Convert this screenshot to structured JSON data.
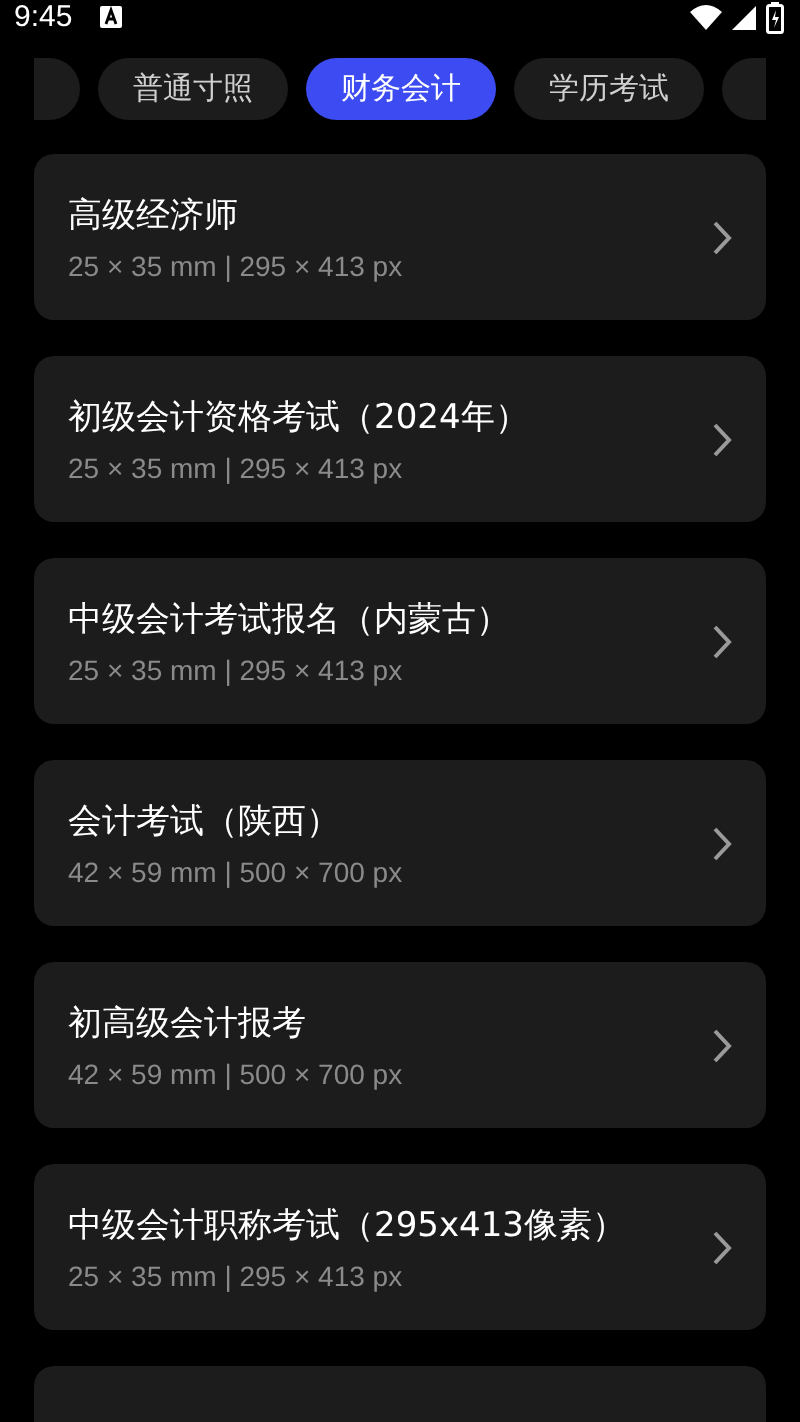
{
  "status_bar": {
    "time": "9:45"
  },
  "tabs": [
    {
      "selected": false
    },
    {
      "label": "普通寸照",
      "selected": false
    },
    {
      "label": "财务会计",
      "selected": true
    },
    {
      "label": "学历考试",
      "selected": false
    },
    {
      "selected": false
    }
  ],
  "items": [
    {
      "kind": "entry",
      "title": "高级经济师",
      "size": "25 × 35 mm | 295 × 413 px"
    },
    {
      "kind": "entry",
      "title": "初级会计资格考试（2024年）",
      "size": "25 × 35 mm | 295 × 413 px"
    },
    {
      "kind": "entry",
      "title": "中级会计考试报名（内蒙古）",
      "size": "25 × 35 mm | 295 × 413 px"
    },
    {
      "kind": "entry",
      "title": "会计考试（陕西）",
      "size": "42 × 59 mm | 500 × 700 px"
    },
    {
      "kind": "entry",
      "title": "初高级会计报考",
      "size": "42 × 59 mm | 500 × 700 px"
    },
    {
      "kind": "entry",
      "title": "中级会计职称考试（295x413像素）",
      "size": "25 × 35 mm | 295 × 413 px"
    },
    {
      "kind": "cut"
    }
  ]
}
